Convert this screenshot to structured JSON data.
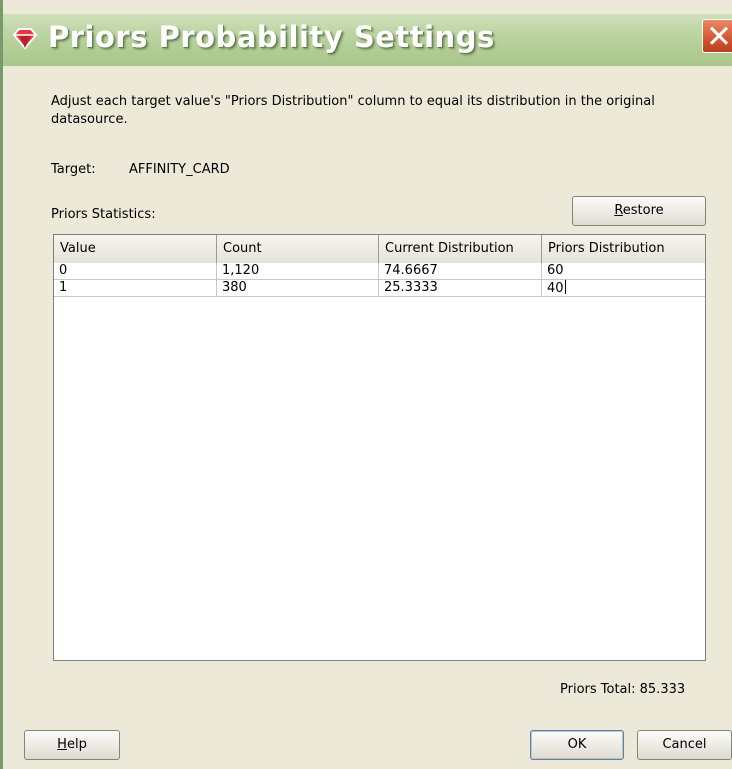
{
  "dialog": {
    "title": "Priors Probability Settings",
    "icon": "diamond-icon",
    "close_glyph": "✕",
    "instructions": "Adjust each target value's \"Priors Distribution\" column to equal its distribution in the original datasource.",
    "target_label": "Target:",
    "target_value": "AFFINITY_CARD",
    "stats_label": "Priors Statistics:",
    "restore_label_prefix": "",
    "restore_mnemonic": "R",
    "restore_label_rest": "estore",
    "table": {
      "headers": [
        "Value",
        "Count",
        "Current Distribution",
        "Priors Distribution"
      ],
      "rows": [
        [
          "0",
          "1,120",
          "74.6667",
          "60"
        ],
        [
          "1",
          "380",
          "25.3333",
          "40"
        ]
      ]
    },
    "priors_total": "Priors Total: 85.333",
    "help_mnemonic": "H",
    "help_rest": "elp",
    "ok_label": "OK",
    "cancel_label": "Cancel",
    "colors": {
      "titlebar": "#b9d29f",
      "close_button": "#d2552f",
      "background": "#ECE9D8"
    }
  }
}
